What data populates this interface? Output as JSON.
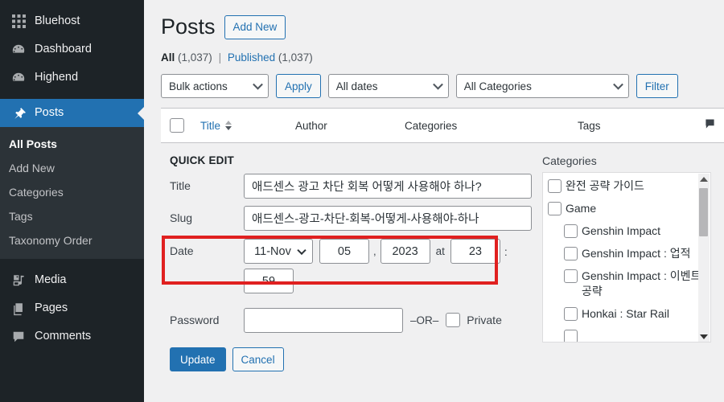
{
  "sidebar": {
    "items": [
      {
        "label": "Bluehost",
        "icon": "grid-icon",
        "current": false
      },
      {
        "label": "Dashboard",
        "icon": "gauge-icon",
        "current": false
      },
      {
        "label": "Highend",
        "icon": "gauge-icon",
        "current": false
      },
      {
        "label": "Posts",
        "icon": "pin-icon",
        "current": true
      }
    ],
    "submenu": [
      {
        "label": "All Posts",
        "active": true
      },
      {
        "label": "Add New",
        "active": false
      },
      {
        "label": "Categories",
        "active": false
      },
      {
        "label": "Tags",
        "active": false
      },
      {
        "label": "Taxonomy Order",
        "active": false
      }
    ],
    "items_after": [
      {
        "label": "Media",
        "icon": "media-icon",
        "current": false
      },
      {
        "label": "Pages",
        "icon": "pages-icon",
        "current": false
      },
      {
        "label": "Comments",
        "icon": "comment-icon",
        "current": false
      }
    ]
  },
  "header": {
    "title": "Posts",
    "add_new_label": "Add New"
  },
  "status_links": {
    "all_label": "All",
    "all_count": "(1,037)",
    "separator": "|",
    "published_label": "Published",
    "published_count": "(1,037)"
  },
  "tablenav": {
    "bulk_actions": "Bulk actions",
    "apply_label": "Apply",
    "all_dates": "All dates",
    "all_categories": "All Categories",
    "filter_label": "Filter"
  },
  "table_headers": {
    "title": "Title",
    "author": "Author",
    "categories": "Categories",
    "tags": "Tags",
    "comments_icon": "comment-bubble-icon"
  },
  "quick_edit": {
    "legend": "QUICK EDIT",
    "title_label": "Title",
    "title_value": "애드센스 광고 차단 회복 어떻게 사용해야 하나?",
    "slug_label": "Slug",
    "slug_value": "애드센스-광고-차단-회복-어떻게-사용해야-하나",
    "date_label": "Date",
    "date_month": "11-Nov",
    "date_day": "05",
    "date_comma": ",",
    "date_year": "2023",
    "date_at": "at",
    "date_hour": "23",
    "date_colon": ":",
    "date_minute": "59",
    "password_label": "Password",
    "password_value": "",
    "or_label": "–OR–",
    "private_label": "Private",
    "update_label": "Update",
    "cancel_label": "Cancel"
  },
  "categories_panel": {
    "title": "Categories",
    "items": [
      {
        "label": "완전 공략 가이드",
        "child": false
      },
      {
        "label": "Game",
        "child": false
      },
      {
        "label": "Genshin Impact",
        "child": true
      },
      {
        "label": "Genshin Impact : 업적",
        "child": true
      },
      {
        "label": "Genshin Impact : 이벤트 공략",
        "child": true
      },
      {
        "label": "Honkai : Star Rail",
        "child": true
      }
    ]
  },
  "colors": {
    "accent": "#2271b1",
    "sidebar_bg": "#1d2327",
    "submenu_bg": "#2c3338",
    "page_bg": "#f0f0f1",
    "annotation": "#e02020"
  }
}
